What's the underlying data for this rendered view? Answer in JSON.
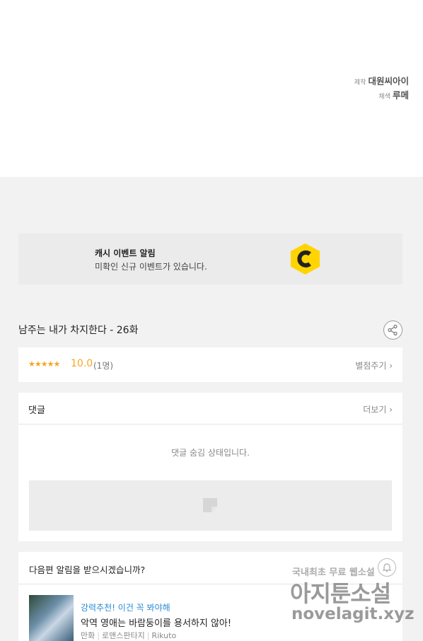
{
  "credits": {
    "production_label": "제작",
    "production_value": "대원씨아이",
    "coloring_label": "채색",
    "coloring_value": "루메"
  },
  "event_banner": {
    "title": "캐시 이벤트 알림",
    "description": "미확인 신규 이벤트가 있습니다.",
    "logo_letter": "C",
    "accent": "#ffd400"
  },
  "episode": {
    "title": "남주는 내가 차지한다 - 26화"
  },
  "rating": {
    "stars": "★★★★★",
    "score": "10.0",
    "count": "(1명)",
    "rate_button": "별점주기 ›"
  },
  "comments": {
    "title": "댓글",
    "more": "더보기 ›",
    "empty_message": "댓글 숨김 상태입니다."
  },
  "next_episode": {
    "question": "다음편 알림을 받으시겠습니까?",
    "recommend_label": "강력추천! 이건 꼭 봐야해",
    "recommend_title": "악역 영애는 바람둥이를 용서하지 않아!",
    "meta": [
      "만화",
      "로맨스판타지",
      "Rikuto"
    ]
  },
  "watermark": {
    "line1": "국내최초 무료 웹소설",
    "line2": "아지툰소설",
    "line3": "novelagit.xyz"
  }
}
